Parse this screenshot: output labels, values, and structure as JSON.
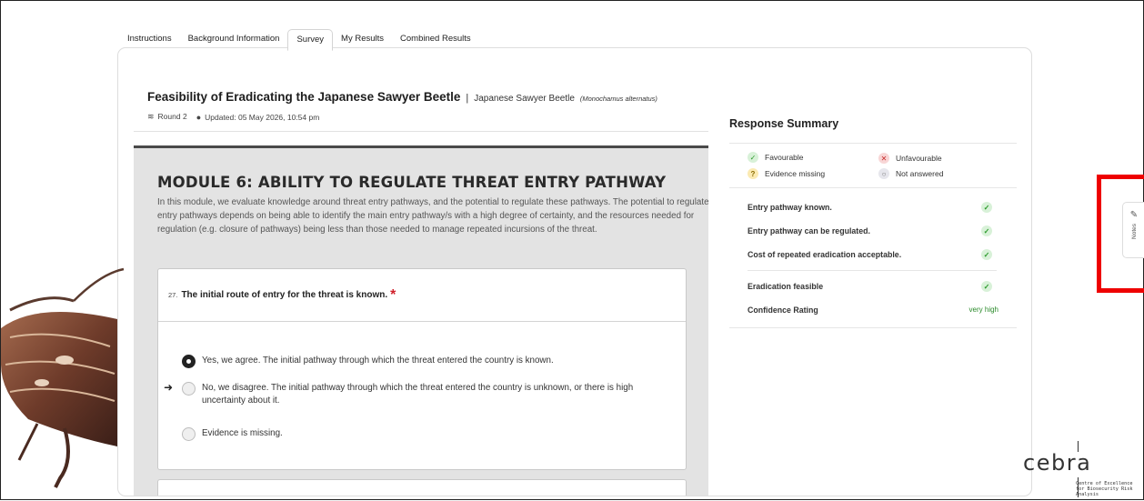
{
  "tabs": [
    {
      "label": "Instructions"
    },
    {
      "label": "Background Information"
    },
    {
      "label": "Survey",
      "active": true
    },
    {
      "label": "My Results"
    },
    {
      "label": "Combined Results"
    }
  ],
  "header": {
    "title": "Feasibility of Eradicating the Japanese Sawyer Beetle",
    "separator": "|",
    "subject": "Japanese Sawyer Beetle",
    "scientific_name": "(Monochamus alternatus)",
    "round": "Round 2",
    "updated": "Updated: 05 May 2026, 10:54 pm"
  },
  "module": {
    "title": "MODULE 6: ABILITY TO REGULATE THREAT ENTRY PATHWAY",
    "description": "In this module, we evaluate knowledge around threat entry pathways, and the potential to regulate these pathways. The potential to regulate entry pathways depends on being able to identify the main entry pathway/s with a high degree of certainty, and the resources needed for regulation (e.g. closure of pathways) being less than those needed to manage repeated incursions of the threat."
  },
  "question": {
    "number": "27.",
    "text": "The initial route of entry for the threat is known.",
    "required_mark": "*",
    "options": [
      {
        "label": "Yes, we agree. The initial pathway through which the threat entered the country is known.",
        "selected": true
      },
      {
        "label": "No, we disagree. The initial pathway through which the threat entered the country is unknown, or there is high uncertainty about it.",
        "selected": false,
        "pointer": "➜"
      },
      {
        "label": "Evidence is missing.",
        "selected": false
      }
    ]
  },
  "summary": {
    "title": "Response Summary",
    "legend": {
      "favourable": "Favourable",
      "unfavourable": "Unfavourable",
      "missing": "Evidence missing",
      "not_answered": "Not answered"
    },
    "rows": [
      {
        "label": "Entry pathway known.",
        "status": "favourable"
      },
      {
        "label": "Entry pathway can be regulated.",
        "status": "favourable"
      },
      {
        "label": "Cost of repeated eradication acceptable.",
        "status": "favourable"
      }
    ],
    "eradication_label": "Eradication feasible",
    "confidence_label": "Confidence Rating",
    "confidence_value": "very high"
  },
  "notes_tab": {
    "label": "Notes"
  },
  "logo": {
    "word": "cebra",
    "tagline": "Centre of Excellence for Biosecurity Risk Analysis"
  },
  "colors": {
    "favourable": "#2a9a2a",
    "unfavourable": "#c62828",
    "highlight": "#ee0000"
  }
}
